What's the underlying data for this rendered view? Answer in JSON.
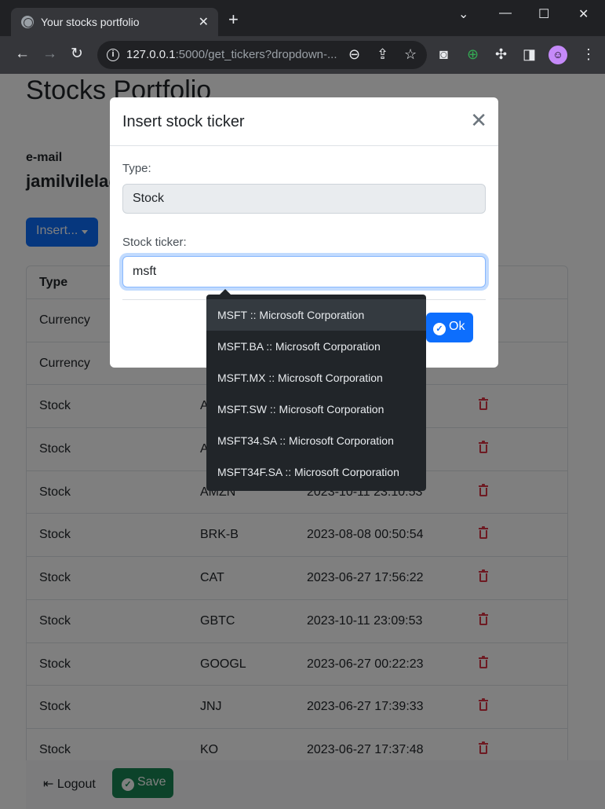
{
  "browser": {
    "tab_title": "Your stocks portfolio",
    "url_host": "127.0.0.1",
    "url_rest": ":5000/get_tickers?dropdown-..."
  },
  "page": {
    "title": "Stocks Portfolio",
    "email_label": "e-mail",
    "email_value": "jamilvilela@",
    "insert_button": "Insert...",
    "table": {
      "header_type": "Type",
      "rows": [
        {
          "type": "Currency",
          "ticker": "",
          "date": ""
        },
        {
          "type": "Currency",
          "ticker": "",
          "date": ""
        },
        {
          "type": "Stock",
          "ticker": "A",
          "date": ""
        },
        {
          "type": "Stock",
          "ticker": "A",
          "date": ""
        },
        {
          "type": "Stock",
          "ticker": "AMZN",
          "date": "2023-10-11 23:10:53"
        },
        {
          "type": "Stock",
          "ticker": "BRK-B",
          "date": "2023-08-08 00:50:54"
        },
        {
          "type": "Stock",
          "ticker": "CAT",
          "date": "2023-06-27 17:56:22"
        },
        {
          "type": "Stock",
          "ticker": "GBTC",
          "date": "2023-10-11 23:09:53"
        },
        {
          "type": "Stock",
          "ticker": "GOOGL",
          "date": "2023-06-27 00:22:23"
        },
        {
          "type": "Stock",
          "ticker": "JNJ",
          "date": "2023-06-27 17:39:33"
        },
        {
          "type": "Stock",
          "ticker": "KO",
          "date": "2023-06-27 17:37:48"
        }
      ]
    },
    "logout_button": "Logout",
    "save_button": "Save"
  },
  "modal": {
    "title": "Insert stock ticker",
    "type_label": "Type:",
    "type_value": "Stock",
    "ticker_label": "Stock ticker:",
    "ticker_value": "msft",
    "ok_button": "Ok"
  },
  "dropdown": {
    "items": [
      "MSFT :: Microsoft Corporation",
      "MSFT.BA :: Microsoft Corporation",
      "MSFT.MX :: Microsoft Corporation",
      "MSFT.SW :: Microsoft Corporation",
      "MSFT34.SA :: Microsoft Corporation",
      "MSFT34F.SA :: Microsoft Corporation"
    ],
    "active_index": 0
  },
  "colors": {
    "primary": "#0d6efd",
    "success": "#198754",
    "danger": "#dc3545",
    "dropdown_bg": "#212529"
  }
}
